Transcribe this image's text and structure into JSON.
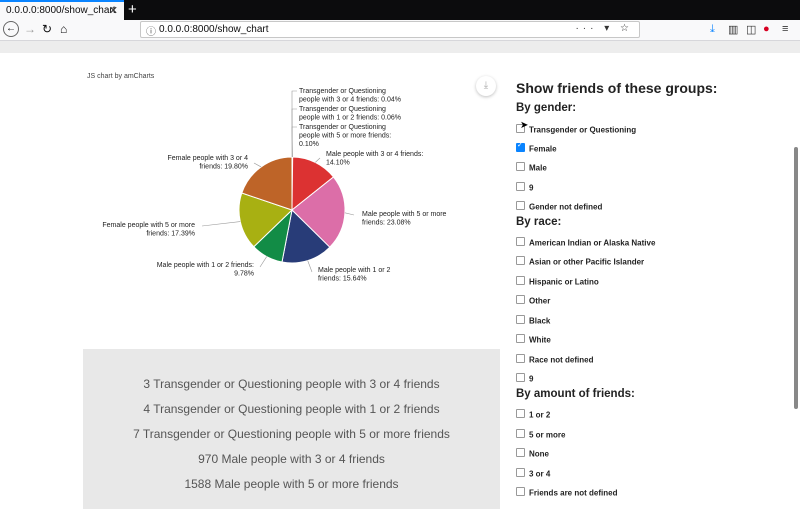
{
  "browser": {
    "tab_title": "0.0.0.0:8000/show_chart",
    "url": "0.0.0.0:8000/show_chart",
    "url_icons": "··· ▾ ☆"
  },
  "chart": {
    "credit": "JS chart by amCharts"
  },
  "chart_data": {
    "type": "pie",
    "slices": [
      {
        "label": "Transgender or Questioning people with 3 or 4 friends",
        "value": 0.04,
        "color": "#c8b400"
      },
      {
        "label": "Transgender or Questioning people with 1 or 2 friends",
        "value": 0.06,
        "color": "#78a01e"
      },
      {
        "label": "Transgender or Questioning people with 5 or more friends",
        "value": 0.1,
        "color": "#3c9a3c"
      },
      {
        "label": "Male people with 3 or 4 friends",
        "value": 14.1,
        "color": "#dc3232"
      },
      {
        "label": "Male people with 5 or more friends",
        "value": 23.08,
        "color": "#dc6ea8"
      },
      {
        "label": "Male people with 1 or 2 friends",
        "value": 15.64,
        "color": "#283c78"
      },
      {
        "label": "Male people with 1 or 2 friends",
        "value": 9.78,
        "color": "#128c46"
      },
      {
        "label": "Female people with 5 or more friends",
        "value": 17.39,
        "color": "#a8b012"
      },
      {
        "label": "Female people with 3 or 4 friends",
        "value": 19.8,
        "color": "#be6428"
      }
    ],
    "label_text": [
      [
        "Transgender or Questioning",
        "people with 3 or 4 friends: 0.04%"
      ],
      [
        "Transgender or Questioning",
        "people with 1 or 2 friends: 0.06%"
      ],
      [
        "Transgender or Questioning",
        "people with 5 or more friends:",
        "0.10%"
      ],
      [
        "Male people with 3 or 4 friends:",
        "14.10%"
      ],
      [
        "Male people with 5 or more",
        "friends: 23.08%"
      ],
      [
        "Male people with 1 or 2",
        "friends: 15.64%"
      ],
      [
        "Male people with 1 or 2 friends:",
        "9.78%"
      ],
      [
        "Female people with 5 or more",
        "friends: 17.39%"
      ],
      [
        "Female people with 3 or 4",
        "friends: 19.80%"
      ]
    ]
  },
  "summary": [
    "3 Transgender or Questioning people with 3 or 4 friends",
    "4 Transgender or Questioning people with 1 or 2 friends",
    "7 Transgender or Questioning people with 5 or more friends",
    "970 Male people with 3 or 4 friends",
    "1588 Male people with 5 or more friends"
  ],
  "filters": {
    "heading": "Show friends of these groups:",
    "groups": [
      {
        "title": "By gender:",
        "items": [
          {
            "label": "Transgender or Questioning",
            "checked": false
          },
          {
            "label": "Female",
            "checked": true
          },
          {
            "label": "Male",
            "checked": false
          },
          {
            "label": "9",
            "checked": false
          },
          {
            "label": "Gender not defined",
            "checked": false
          }
        ]
      },
      {
        "title": "By race:",
        "items": [
          {
            "label": "American Indian or Alaska Native",
            "checked": false
          },
          {
            "label": "Asian or other Pacific Islander",
            "checked": false
          },
          {
            "label": "Hispanic or Latino",
            "checked": false
          },
          {
            "label": "Other",
            "checked": false
          },
          {
            "label": "Black",
            "checked": false
          },
          {
            "label": "White",
            "checked": false
          },
          {
            "label": "Race not defined",
            "checked": false
          },
          {
            "label": "9",
            "checked": false
          }
        ]
      },
      {
        "title": "By amount of friends:",
        "items": [
          {
            "label": "1 or 2",
            "checked": false
          },
          {
            "label": "5 or more",
            "checked": false
          },
          {
            "label": "None",
            "checked": false
          },
          {
            "label": "3 or 4",
            "checked": false
          },
          {
            "label": "Friends are not defined",
            "checked": false
          }
        ]
      }
    ]
  }
}
